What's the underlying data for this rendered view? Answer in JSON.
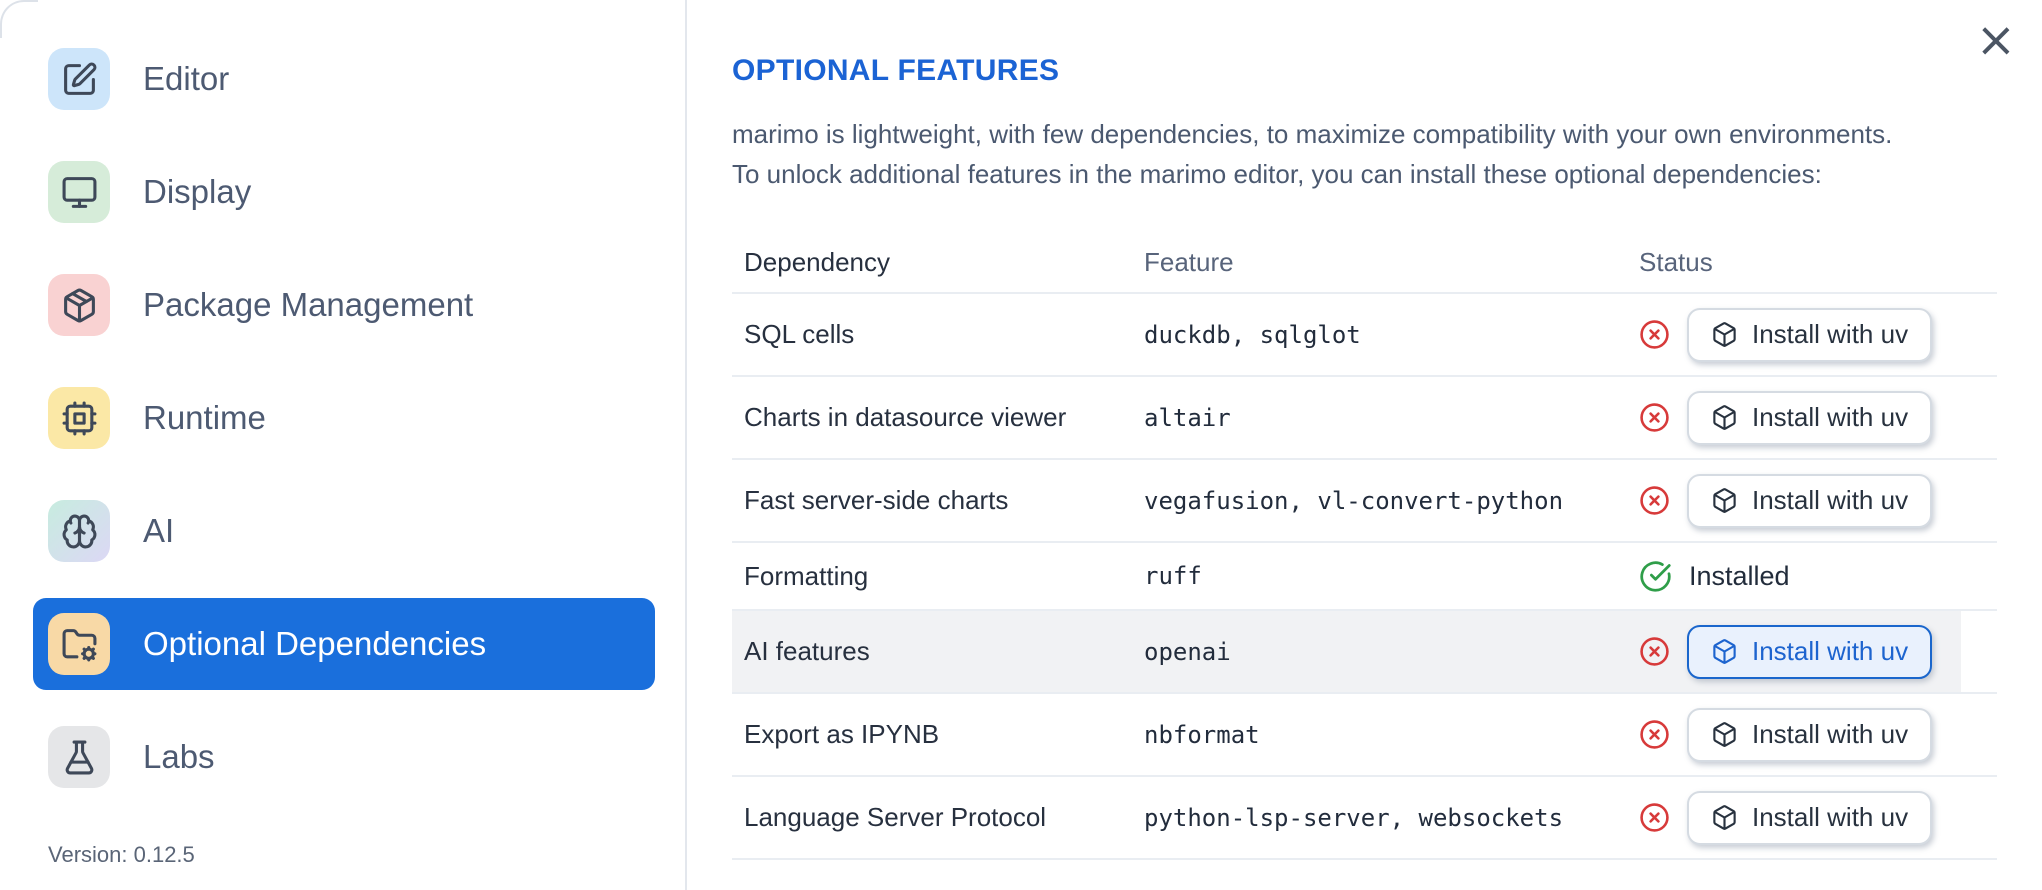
{
  "colors": {
    "accent": "#1a6fdc",
    "heading": "#1b63d4",
    "red": "#d73a3a",
    "green": "#2f9e49"
  },
  "sidebar": {
    "items": [
      {
        "label": "Editor",
        "icon": "square-pen-icon",
        "selected": false
      },
      {
        "label": "Display",
        "icon": "monitor-icon",
        "selected": false
      },
      {
        "label": "Package Management",
        "icon": "package-icon",
        "selected": false
      },
      {
        "label": "Runtime",
        "icon": "cpu-icon",
        "selected": false
      },
      {
        "label": "AI",
        "icon": "brain-icon",
        "selected": false
      },
      {
        "label": "Optional Dependencies",
        "icon": "folder-cog-icon",
        "selected": true
      },
      {
        "label": "Labs",
        "icon": "flask-icon",
        "selected": false
      }
    ],
    "version_label": "Version: 0.12.5"
  },
  "dialog": {
    "title": "OPTIONAL FEATURES",
    "description_lines": [
      "marimo is lightweight, with few dependencies, to maximize compatibility with your own environments.",
      "To unlock additional features in the marimo editor, you can install these optional dependencies:"
    ],
    "close_icon_glyph": "×"
  },
  "table": {
    "columns": [
      "Dependency",
      "Feature",
      "Status"
    ],
    "install_button_label": "Install with uv",
    "install_button_icon": "box-icon",
    "not_installed_icon": "circle-x-icon",
    "installed_icon": "circle-check-icon",
    "installed_label": "Installed",
    "rows": [
      {
        "dependency": "SQL cells",
        "feature": "duckdb, sqlglot",
        "status": "not-installed",
        "highlighted": false
      },
      {
        "dependency": "Charts in datasource viewer",
        "feature": "altair",
        "status": "not-installed",
        "highlighted": false
      },
      {
        "dependency": "Fast server-side charts",
        "feature": "vegafusion, vl-convert-python",
        "status": "not-installed",
        "highlighted": false
      },
      {
        "dependency": "Formatting",
        "feature": "ruff",
        "status": "installed",
        "highlighted": false
      },
      {
        "dependency": "AI features",
        "feature": "openai",
        "status": "not-installed",
        "highlighted": true
      },
      {
        "dependency": "Export as IPYNB",
        "feature": "nbformat",
        "status": "not-installed",
        "highlighted": false
      },
      {
        "dependency": "Language Server Protocol",
        "feature": "python-lsp-server, websockets",
        "status": "not-installed",
        "highlighted": false
      }
    ]
  }
}
